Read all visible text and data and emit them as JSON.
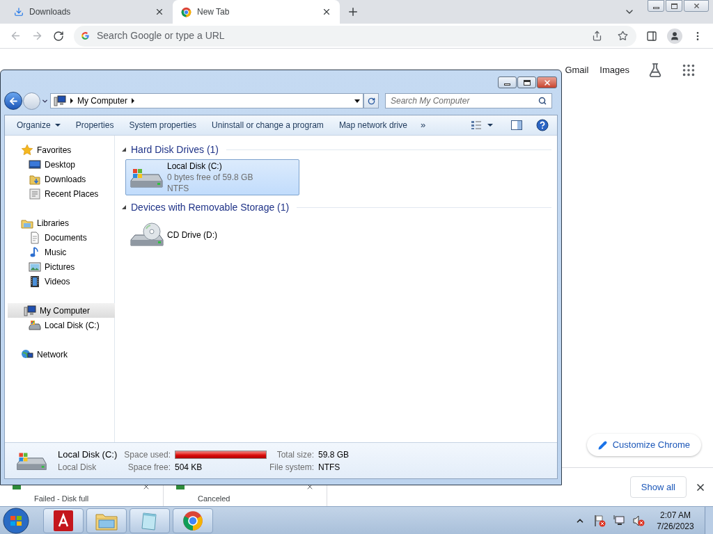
{
  "browser": {
    "tabs": [
      {
        "kind": "download",
        "title": "Downloads",
        "selected": false
      },
      {
        "kind": "chrome",
        "title": "New Tab",
        "selected": true
      }
    ],
    "omnibox": {
      "placeholder": "Search Google or type a URL"
    }
  },
  "new_tab_page": {
    "links": [
      "Gmail",
      "Images"
    ],
    "customize_button": "Customize Chrome"
  },
  "explorer": {
    "breadcrumb": [
      "My Computer"
    ],
    "search": {
      "placeholder": "Search My Computer"
    },
    "commands": [
      {
        "label": "Organize",
        "menu": true
      },
      {
        "label": "Properties",
        "menu": false
      },
      {
        "label": "System properties",
        "menu": false
      },
      {
        "label": "Uninstall or change a program",
        "menu": false
      },
      {
        "label": "Map network drive",
        "menu": false
      }
    ],
    "more": "»",
    "nav": [
      {
        "kind": "star",
        "label": "Favorites",
        "selected": false,
        "children": [
          {
            "kind": "desktop",
            "label": "Desktop",
            "selected": false
          },
          {
            "kind": "downloads",
            "label": "Downloads",
            "selected": false
          },
          {
            "kind": "recent",
            "label": "Recent Places",
            "selected": false
          }
        ]
      },
      {
        "kind": "library",
        "label": "Libraries",
        "selected": false,
        "children": [
          {
            "kind": "document",
            "label": "Documents",
            "selected": false
          },
          {
            "kind": "music",
            "label": "Music",
            "selected": false
          },
          {
            "kind": "pictures",
            "label": "Pictures",
            "selected": false
          },
          {
            "kind": "videos",
            "label": "Videos",
            "selected": false
          }
        ]
      },
      {
        "kind": "computer",
        "label": "My Computer",
        "selected": true,
        "children": [
          {
            "kind": "disk",
            "label": "Local Disk (C:)",
            "selected": false
          }
        ]
      },
      {
        "kind": "network",
        "label": "Network",
        "selected": false
      }
    ],
    "groups": [
      {
        "title": "Hard Disk Drives (1)",
        "items": [
          {
            "kind": "hdd",
            "name": "Local Disk (C:)",
            "selected": true,
            "details": [
              "0 bytes free of 59.8 GB",
              "NTFS"
            ]
          }
        ]
      },
      {
        "title": "Devices with Removable Storage (1)",
        "items": [
          {
            "kind": "cd",
            "name": "CD Drive (D:)",
            "selected": false
          }
        ]
      }
    ],
    "details_pane": {
      "name": "Local Disk (C:)",
      "type": "Local Disk",
      "space_used": {
        "label": "Space used:",
        "level": 1
      },
      "space_free": {
        "label": "Space free:",
        "value": "504 KB"
      },
      "total_size": {
        "label": "Total size:",
        "value": "59.8 GB"
      },
      "file_system": {
        "label": "File system:",
        "value": "NTFS"
      }
    }
  },
  "download_shelf": {
    "items": [
      {
        "status": "Failed - Disk full"
      },
      {
        "status": "Canceled"
      }
    ],
    "show_all": "Show all"
  },
  "taskbar": {
    "apps": [
      {
        "kind": "adobe"
      },
      {
        "kind": "folders"
      },
      {
        "kind": "notepad"
      },
      {
        "kind": "chrome"
      }
    ],
    "clock": {
      "time": "2:07 AM",
      "date": "7/26/2023"
    }
  }
}
